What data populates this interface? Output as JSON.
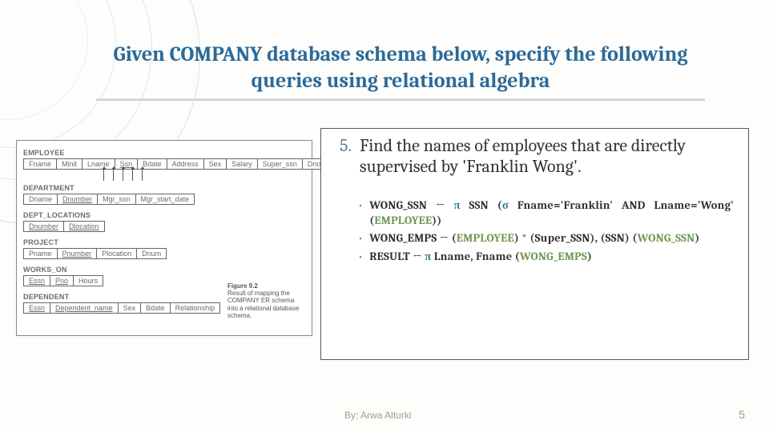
{
  "title": {
    "line": "Given COMPANY database schema below, specify the following queries using relational algebra"
  },
  "schema": {
    "tables": {
      "employee": {
        "name": "EMPLOYEE",
        "cols": [
          "Fname",
          "Minit",
          "Lname",
          "Ssn",
          "Bdate",
          "Address",
          "Sex",
          "Salary",
          "Super_ssn",
          "Dno"
        ]
      },
      "department": {
        "name": "DEPARTMENT",
        "cols": [
          "Dname",
          "Dnumber",
          "Mgr_ssn",
          "Mgr_start_date"
        ]
      },
      "dept_locations": {
        "name": "DEPT_LOCATIONS",
        "cols": [
          "Dnumber",
          "Dlocation"
        ]
      },
      "project": {
        "name": "PROJECT",
        "cols": [
          "Pname",
          "Pnumber",
          "Plocation",
          "Dnum"
        ]
      },
      "works_on": {
        "name": "WORKS_ON",
        "cols": [
          "Essn",
          "Pno",
          "Hours"
        ]
      },
      "dependent": {
        "name": "DEPENDENT",
        "cols": [
          "Essn",
          "Dependent_name",
          "Sex",
          "Bdate",
          "Relationship"
        ]
      }
    },
    "figure": {
      "heading": "Figure 9.2",
      "caption": "Result of mapping the COMPANY ER schema into a relational database schema."
    }
  },
  "question": {
    "number": "5.",
    "text": "Find the names of employees that are directly supervised by 'Franklin Wong'."
  },
  "algebra": {
    "line1": {
      "lhs": "WONG_SSN",
      "arrow": "←",
      "pi": "π",
      "projcols": "SSN",
      "sigma": "σ",
      "cond_pre": "Fname='Franklin' AND Lname='Wong'",
      "rel": "EMPLOYEE"
    },
    "line2": {
      "lhs": "WONG_EMPS",
      "arrow": "←",
      "rel1": "EMPLOYEE",
      "natjoin": "*",
      "renamecols": "(Super_SSN), (SSN)",
      "rel2": "WONG_SSN"
    },
    "line3": {
      "lhs": "RESULT",
      "arrow": "←",
      "pi": "π",
      "projcols": "Lname, Fname",
      "rel": "WONG_EMPS"
    }
  },
  "footer": {
    "author": "By: Arwa Alturki",
    "page": "5"
  }
}
